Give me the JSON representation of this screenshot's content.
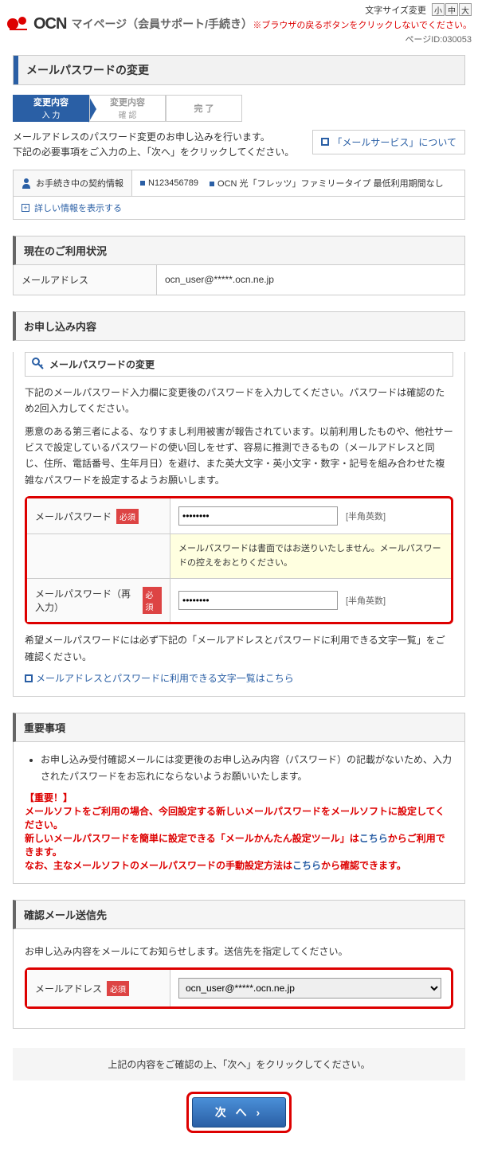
{
  "header": {
    "logo": "OCN",
    "page_title": "マイページ（会員サポート/手続き）",
    "font_size_label": "文字サイズ変更",
    "size_btns": [
      "小",
      "中",
      "大"
    ],
    "browser_warn": "※ブラウザの戻るボタンをクリックしないでください。",
    "page_id_label": "ページID:",
    "page_id": "030053"
  },
  "main_title": "メールパスワードの変更",
  "steps": [
    {
      "line1": "変更内容",
      "line2": "入 力"
    },
    {
      "line1": "変更内容",
      "line2": "確 認"
    },
    {
      "line1": "完 了",
      "line2": ""
    }
  ],
  "intro1": "メールアドレスのパスワード変更のお申し込みを行います。",
  "intro2": "下記の必要事項をご入力の上、「次へ」をクリックしてください。",
  "side_link": "「メールサービス」について",
  "contract": {
    "label": "お手続き中の契約情報",
    "number": "N123456789",
    "plan": "OCN 光「フレッツ」ファミリータイプ 最低利用期間なし",
    "expand": "詳しい情報を表示する"
  },
  "usage": {
    "heading": "現在のご利用状況",
    "mail_label": "メールアドレス",
    "mail_value": "ocn_user@*****.ocn.ne.jp"
  },
  "apply": {
    "heading": "お申し込み内容",
    "sub_heading": "メールパスワードの変更",
    "p1": "下記のメールパスワード入力欄に変更後のパスワードを入力してください。パスワードは確認のため2回入力してください。",
    "p2": "悪意のある第三者による、なりすまし利用被害が報告されています。以前利用したものや、他社サービスで設定しているパスワードの使い回しをせず、容易に推測できるもの（メールアドレスと同じ、住所、電話番号、生年月日）を避け、また英大文字・英小文字・数字・記号を組み合わせた複雑なパスワードを設定するようお願いします。",
    "pw_label": "メールパスワード",
    "pw_re_label": "メールパスワード（再入力）",
    "req": "必須",
    "pw_hint": "[半角英数]",
    "pw_note": "メールパスワードは書面ではお送りいたしません。メールパスワードの控えをおとりください。",
    "after1": "希望メールパスワードには必ず下記の「メールアドレスとパスワードに利用できる文字一覧」をご確認ください。",
    "after_link": "メールアドレスとパスワードに利用できる文字一覧はこちら"
  },
  "important": {
    "heading": "重要事項",
    "li1": "お申し込み受付確認メールには変更後のお申し込み内容（パスワード）の記載がないため、入力されたパスワードをお忘れにならないようお願いいたします。",
    "warn_h": "【重要！】",
    "warn1a": "メールソフトをご利用の場合、今回設定する新しいメールパスワードをメールソフトに設定してください。",
    "warn2a": "新しいメールパスワードを簡単に設定できる「メールかんたん設定ツール」は",
    "warn2b": "こちら",
    "warn2c": "からご利用できます。",
    "warn3a": "なお、主なメールソフトのメールパスワードの手動設定方法は",
    "warn3b": "こちら",
    "warn3c": "から確認できます。"
  },
  "confirm": {
    "heading": "確認メール送信先",
    "p": "お申し込み内容をメールにてお知らせします。送信先を指定してください。",
    "label": "メールアドレス",
    "req": "必須",
    "value": "ocn_user@*****.ocn.ne.jp"
  },
  "footer": "上記の内容をご確認の上、「次へ」をクリックしてください。",
  "next": "次 へ"
}
